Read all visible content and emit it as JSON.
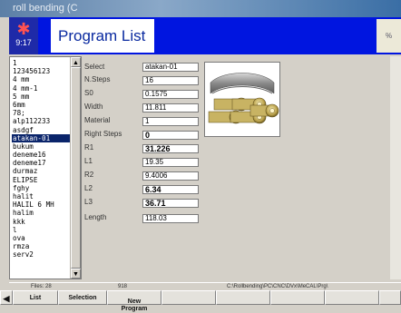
{
  "window": {
    "title": "roll bending (C"
  },
  "header": {
    "logo_text": "9:17",
    "title": "Program List",
    "right_text": "%"
  },
  "program_list": {
    "items": [
      "1",
      "123456123",
      "4 mm",
      "4 mm-1",
      "5 mm",
      "6mm",
      "78;",
      "alp112233",
      "asdgf",
      "atakan-01",
      "bukum",
      "deneme16",
      "deneme17",
      "durmaz",
      "ELIPSE",
      "fghy",
      "halit",
      "HALIL 6 MH",
      "halim",
      "kkk",
      "l",
      "ova",
      "rmza",
      "serv2"
    ],
    "selected_index": 9
  },
  "fields": {
    "select": {
      "label": "Select",
      "value": "atakan-01"
    },
    "nsteps": {
      "label": "N.Steps",
      "value": "16"
    },
    "s0": {
      "label": "S0",
      "value": "0.1575"
    },
    "width": {
      "label": "Width",
      "value": "11.811"
    },
    "material": {
      "label": "Material",
      "value": "1"
    },
    "right": {
      "label": "Right Steps",
      "value": "0"
    },
    "r1": {
      "label": "R1",
      "value": "31.226"
    },
    "l1": {
      "label": "L1",
      "value": "19.35"
    },
    "r2": {
      "label": "R2",
      "value": "9.4006"
    },
    "l2": {
      "label": "L2",
      "value": "6.34"
    },
    "l3": {
      "label": "L3",
      "value": "36.71"
    },
    "length": {
      "label": "Length",
      "value": "118.03"
    }
  },
  "status": {
    "file": "Files: 28",
    "count": "918",
    "path": "C:\\Rollbending\\PC\\CNC\\DVx\\MeCAL\\Prg\\"
  },
  "buttons": {
    "list": "List",
    "selection": "Selection",
    "new_program": "New\nProgram"
  },
  "colors": {
    "header_blue": "#0015e0",
    "selection": "#0a246a"
  },
  "icons": {
    "logo": "flag-logo-icon",
    "preview": "roll-bending-preview-image"
  }
}
